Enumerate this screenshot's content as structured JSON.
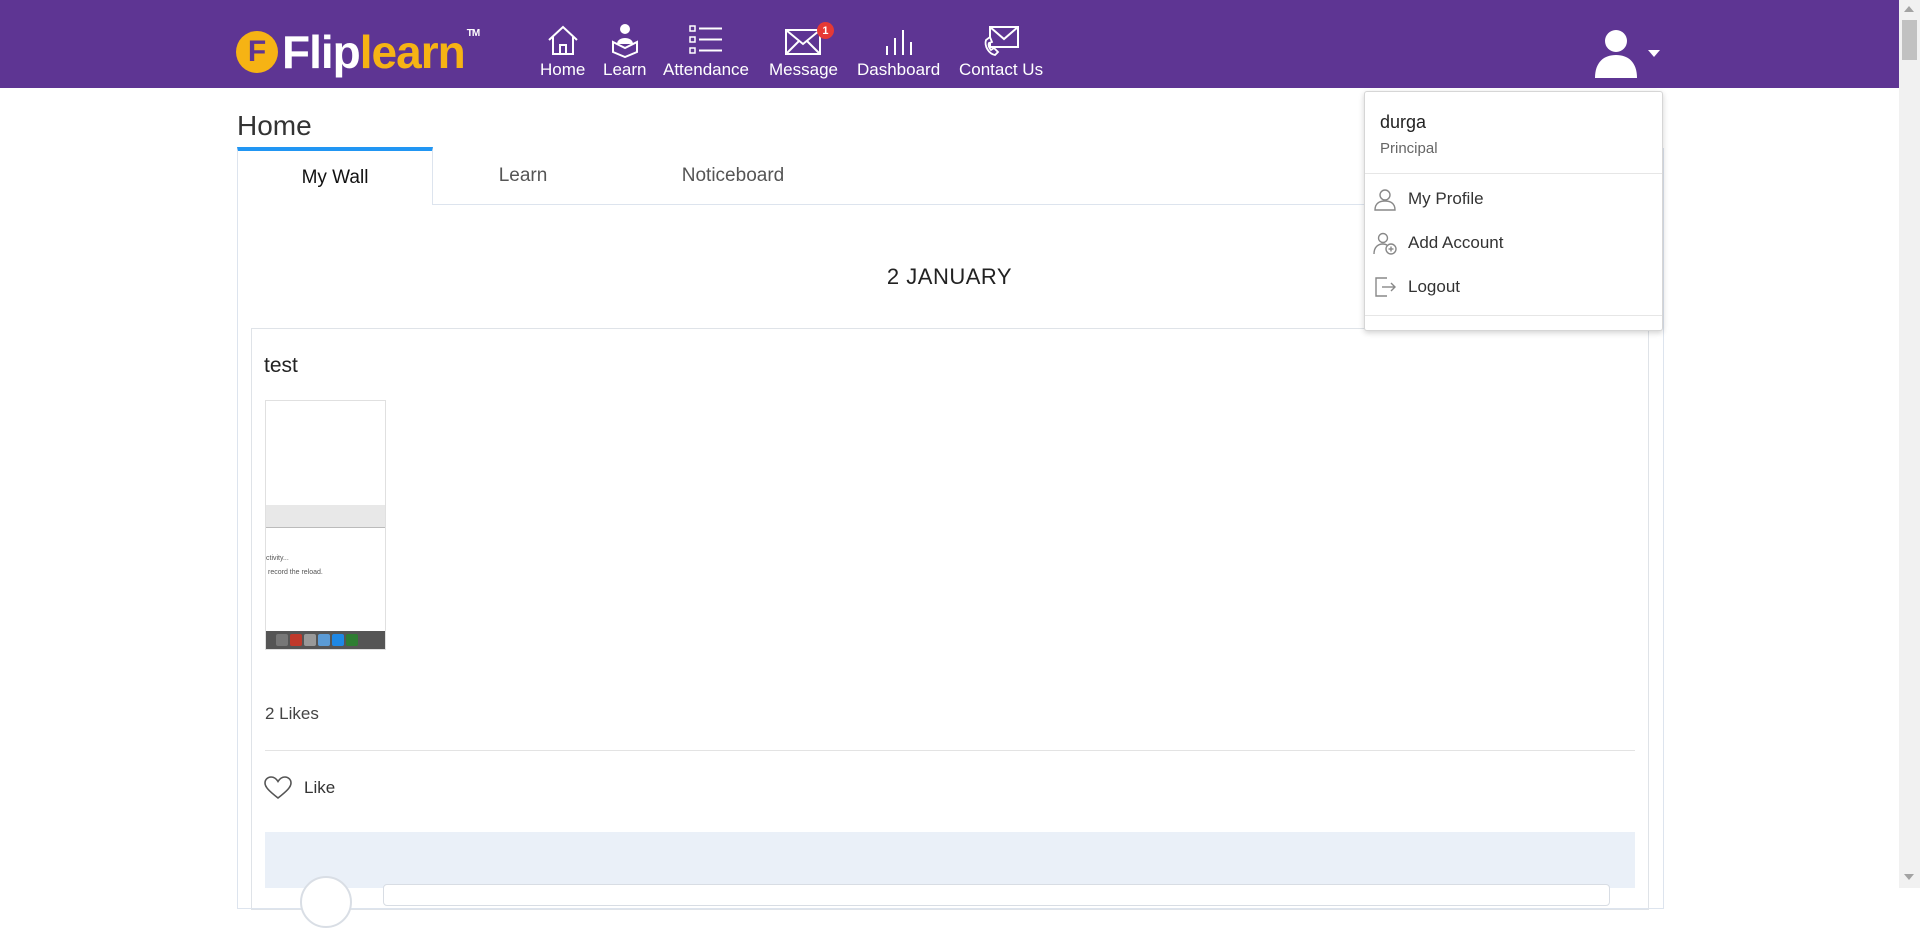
{
  "brand": {
    "logo_letter": "F",
    "name_part1": "Flip",
    "name_part2": "learn",
    "trademark": "TM",
    "purple": "#5e3593",
    "yellow": "#f6b314"
  },
  "nav": [
    {
      "label": "Home",
      "icon": "home-icon"
    },
    {
      "label": "Learn",
      "icon": "learn-icon"
    },
    {
      "label": "Attendance",
      "icon": "attendance-icon"
    },
    {
      "label": "Message",
      "icon": "message-icon",
      "badge": "1"
    },
    {
      "label": "Dashboard",
      "icon": "dashboard-icon"
    },
    {
      "label": "Contact Us",
      "icon": "contact-icon"
    }
  ],
  "page": {
    "title": "Home"
  },
  "tabs": [
    {
      "label": "My Wall",
      "active": true
    },
    {
      "label": "Learn"
    },
    {
      "label": "Noticeboard"
    }
  ],
  "feed": {
    "date": "2 JANUARY",
    "post": {
      "title": "test",
      "thumb_text_1": "ctivity...",
      "thumb_text_2": "record the reload.",
      "likes": "2 Likes",
      "like_label": "Like"
    }
  },
  "user_menu": {
    "name": "durga",
    "role": "Principal",
    "items": [
      {
        "label": "My Profile",
        "icon": "user-icon"
      },
      {
        "label": "Add Account",
        "icon": "add-account-icon"
      },
      {
        "label": "Logout",
        "icon": "logout-icon"
      }
    ]
  }
}
